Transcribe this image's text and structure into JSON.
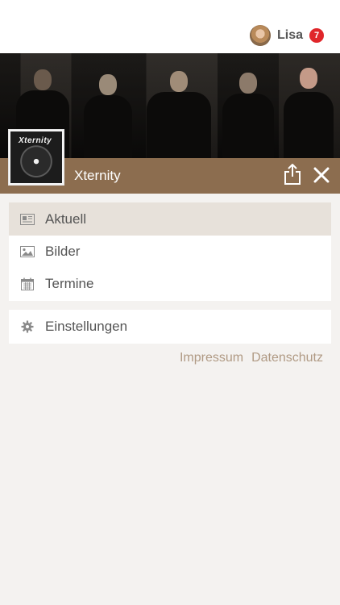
{
  "header": {
    "user_name": "Lisa",
    "notification_count": "7",
    "avatar_icon": "user-avatar-icon"
  },
  "band": {
    "name": "Xternity",
    "thumbnail_logo_text": "Xternity",
    "share_icon": "share-icon",
    "close_icon": "close-icon"
  },
  "menu": {
    "primary_items": [
      {
        "label": "Aktuell",
        "icon": "newspaper-icon",
        "active": true
      },
      {
        "label": "Bilder",
        "icon": "image-icon",
        "active": false
      },
      {
        "label": "Termine",
        "icon": "calendar-icon",
        "active": false
      }
    ],
    "secondary_items": [
      {
        "label": "Einstellungen",
        "icon": "gear-icon"
      }
    ]
  },
  "footer": {
    "impressum": "Impressum",
    "datenschutz": "Datenschutz"
  },
  "colors": {
    "accent_brown": "#8c6d4f",
    "active_item_bg": "#e7e1da",
    "badge_red": "#e0262a",
    "link_color": "#b09a84",
    "page_bg": "#f4f2f0"
  }
}
